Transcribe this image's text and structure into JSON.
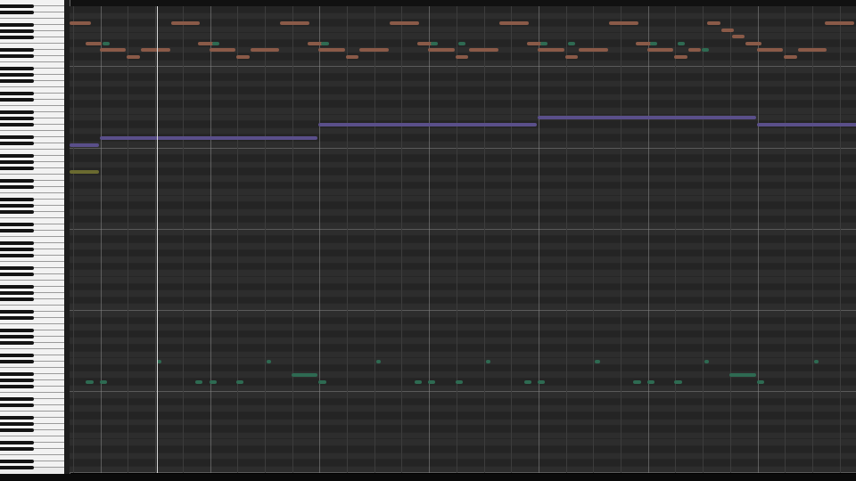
{
  "app": {
    "view": "piano-roll",
    "colors": {
      "background": "#2d2d2d",
      "row_dark": "#242424",
      "beat_line": "#3c3c3c",
      "bar_line": "#8a8a8a",
      "octave_line": "#5a5a5a",
      "playhead": "#d8d8d8",
      "note_orange": "#8a5a48",
      "note_teal": "#2e6a52",
      "note_purple": "#5a4f8a",
      "note_olive": "#6a6a30"
    }
  },
  "keyboard": {
    "white_key_count": 75,
    "black_key_pattern": [
      1,
      1,
      0,
      1,
      1,
      1,
      0
    ]
  },
  "notes": [
    {
      "pitch": 66,
      "start": 0,
      "len": 0.8,
      "color": "orange"
    },
    {
      "pitch": 66,
      "start": 3.7,
      "len": 1.1,
      "color": "orange"
    },
    {
      "pitch": 66,
      "start": 7.7,
      "len": 1.1,
      "color": "orange"
    },
    {
      "pitch": 66,
      "start": 11.7,
      "len": 1.1,
      "color": "orange"
    },
    {
      "pitch": 66,
      "start": 15.7,
      "len": 1.1,
      "color": "orange"
    },
    {
      "pitch": 66,
      "start": 19.7,
      "len": 1.1,
      "color": "orange"
    },
    {
      "pitch": 66,
      "start": 23.3,
      "len": 0.5,
      "color": "orange"
    },
    {
      "pitch": 66,
      "start": 27.6,
      "len": 1.1,
      "color": "orange"
    },
    {
      "pitch": 65,
      "start": 23.8,
      "len": 0.5,
      "color": "orange"
    },
    {
      "pitch": 64,
      "start": 24.2,
      "len": 0.5,
      "color": "orange"
    },
    {
      "pitch": 63,
      "start": 0.6,
      "len": 0.6,
      "color": "orange"
    },
    {
      "pitch": 63,
      "start": 4.7,
      "len": 0.6,
      "color": "orange"
    },
    {
      "pitch": 63,
      "start": 8.7,
      "len": 0.6,
      "color": "orange"
    },
    {
      "pitch": 63,
      "start": 12.7,
      "len": 0.6,
      "color": "orange"
    },
    {
      "pitch": 63,
      "start": 16.7,
      "len": 0.6,
      "color": "orange"
    },
    {
      "pitch": 63,
      "start": 20.7,
      "len": 0.6,
      "color": "orange"
    },
    {
      "pitch": 63,
      "start": 24.7,
      "len": 0.6,
      "color": "orange"
    },
    {
      "pitch": 63,
      "start": 1.2,
      "len": 0.3,
      "color": "teal"
    },
    {
      "pitch": 63,
      "start": 5.2,
      "len": 0.3,
      "color": "teal"
    },
    {
      "pitch": 63,
      "start": 9.2,
      "len": 0.3,
      "color": "teal"
    },
    {
      "pitch": 63,
      "start": 13.2,
      "len": 0.3,
      "color": "teal"
    },
    {
      "pitch": 63,
      "start": 14.2,
      "len": 0.3,
      "color": "teal"
    },
    {
      "pitch": 63,
      "start": 17.2,
      "len": 0.3,
      "color": "teal"
    },
    {
      "pitch": 63,
      "start": 18.2,
      "len": 0.3,
      "color": "teal"
    },
    {
      "pitch": 63,
      "start": 21.2,
      "len": 0.3,
      "color": "teal"
    },
    {
      "pitch": 63,
      "start": 22.2,
      "len": 0.3,
      "color": "teal"
    },
    {
      "pitch": 62,
      "start": 1.1,
      "len": 1.0,
      "color": "orange"
    },
    {
      "pitch": 62,
      "start": 2.6,
      "len": 1.1,
      "color": "orange"
    },
    {
      "pitch": 62,
      "start": 5.1,
      "len": 1.0,
      "color": "orange"
    },
    {
      "pitch": 62,
      "start": 6.6,
      "len": 1.1,
      "color": "orange"
    },
    {
      "pitch": 62,
      "start": 9.1,
      "len": 1.0,
      "color": "orange"
    },
    {
      "pitch": 62,
      "start": 10.6,
      "len": 1.1,
      "color": "orange"
    },
    {
      "pitch": 62,
      "start": 13.1,
      "len": 1.0,
      "color": "orange"
    },
    {
      "pitch": 62,
      "start": 14.6,
      "len": 1.1,
      "color": "orange"
    },
    {
      "pitch": 62,
      "start": 17.1,
      "len": 1.0,
      "color": "orange"
    },
    {
      "pitch": 62,
      "start": 18.6,
      "len": 1.1,
      "color": "orange"
    },
    {
      "pitch": 62,
      "start": 21.1,
      "len": 1.0,
      "color": "orange"
    },
    {
      "pitch": 62,
      "start": 22.6,
      "len": 0.5,
      "color": "orange"
    },
    {
      "pitch": 62,
      "start": 25.1,
      "len": 1.0,
      "color": "orange"
    },
    {
      "pitch": 62,
      "start": 26.6,
      "len": 1.1,
      "color": "orange"
    },
    {
      "pitch": 62,
      "start": 23.1,
      "len": 0.3,
      "color": "teal"
    },
    {
      "pitch": 61,
      "start": 2.1,
      "len": 0.5,
      "color": "orange"
    },
    {
      "pitch": 61,
      "start": 6.1,
      "len": 0.5,
      "color": "orange"
    },
    {
      "pitch": 61,
      "start": 10.1,
      "len": 0.5,
      "color": "orange"
    },
    {
      "pitch": 61,
      "start": 14.1,
      "len": 0.5,
      "color": "orange"
    },
    {
      "pitch": 61,
      "start": 18.1,
      "len": 0.5,
      "color": "orange"
    },
    {
      "pitch": 61,
      "start": 22.1,
      "len": 0.5,
      "color": "orange"
    },
    {
      "pitch": 61,
      "start": 26.1,
      "len": 0.5,
      "color": "orange"
    },
    {
      "pitch": 52,
      "start": 17.1,
      "len": 8.0,
      "color": "purple"
    },
    {
      "pitch": 51,
      "start": 9.1,
      "len": 8.0,
      "color": "purple"
    },
    {
      "pitch": 51,
      "start": 25.1,
      "len": 4.0,
      "color": "purple"
    },
    {
      "pitch": 49,
      "start": 1.1,
      "len": 8.0,
      "color": "purple"
    },
    {
      "pitch": 48,
      "start": 0,
      "len": 1.1,
      "color": "purple"
    },
    {
      "pitch": 44,
      "start": 0,
      "len": 1.1,
      "color": "olive"
    },
    {
      "pitch": 16,
      "start": 3.2,
      "len": 0.2,
      "color": "teal"
    },
    {
      "pitch": 16,
      "start": 7.2,
      "len": 0.2,
      "color": "teal"
    },
    {
      "pitch": 16,
      "start": 11.2,
      "len": 0.2,
      "color": "teal"
    },
    {
      "pitch": 16,
      "start": 15.2,
      "len": 0.2,
      "color": "teal"
    },
    {
      "pitch": 16,
      "start": 19.2,
      "len": 0.2,
      "color": "teal"
    },
    {
      "pitch": 16,
      "start": 23.2,
      "len": 0.2,
      "color": "teal"
    },
    {
      "pitch": 16,
      "start": 27.2,
      "len": 0.2,
      "color": "teal"
    },
    {
      "pitch": 14,
      "start": 8.1,
      "len": 1.0,
      "color": "teal"
    },
    {
      "pitch": 14,
      "start": 24.1,
      "len": 1.0,
      "color": "teal"
    },
    {
      "pitch": 13,
      "start": 0.6,
      "len": 0.3,
      "color": "teal"
    },
    {
      "pitch": 13,
      "start": 1.1,
      "len": 0.3,
      "color": "teal"
    },
    {
      "pitch": 13,
      "start": 4.6,
      "len": 0.3,
      "color": "teal"
    },
    {
      "pitch": 13,
      "start": 5.1,
      "len": 0.3,
      "color": "teal"
    },
    {
      "pitch": 13,
      "start": 6.1,
      "len": 0.3,
      "color": "teal"
    },
    {
      "pitch": 13,
      "start": 9.1,
      "len": 0.3,
      "color": "teal"
    },
    {
      "pitch": 13,
      "start": 12.6,
      "len": 0.3,
      "color": "teal"
    },
    {
      "pitch": 13,
      "start": 13.1,
      "len": 0.3,
      "color": "teal"
    },
    {
      "pitch": 13,
      "start": 14.1,
      "len": 0.3,
      "color": "teal"
    },
    {
      "pitch": 13,
      "start": 16.6,
      "len": 0.3,
      "color": "teal"
    },
    {
      "pitch": 13,
      "start": 17.1,
      "len": 0.3,
      "color": "teal"
    },
    {
      "pitch": 13,
      "start": 20.6,
      "len": 0.3,
      "color": "teal"
    },
    {
      "pitch": 13,
      "start": 21.1,
      "len": 0.3,
      "color": "teal"
    },
    {
      "pitch": 13,
      "start": 22.1,
      "len": 0.3,
      "color": "teal"
    },
    {
      "pitch": 13,
      "start": 25.1,
      "len": 0.3,
      "color": "teal"
    }
  ],
  "playhead_beat": 3.2
}
